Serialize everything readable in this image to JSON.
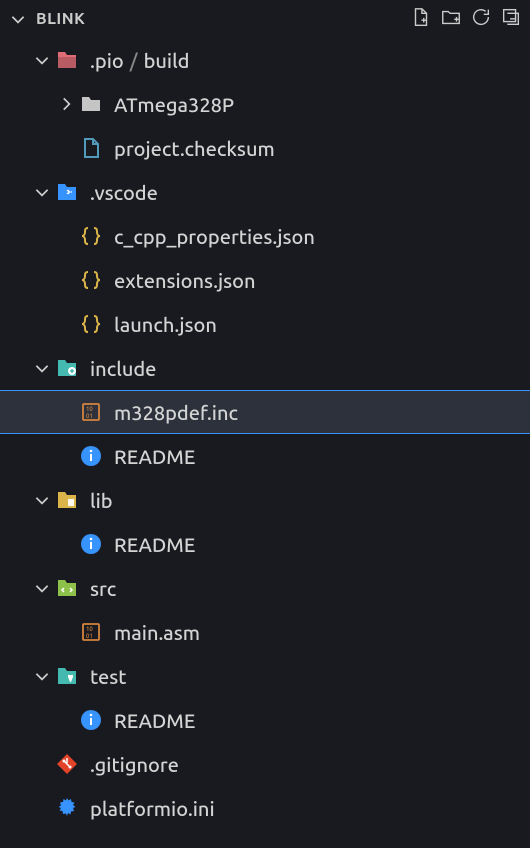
{
  "header": {
    "title": "BLINK"
  },
  "tree": {
    "pio": {
      "part1": ".pio",
      "part2": "build"
    },
    "atmega": "ATmega328P",
    "project_checksum": "project.checksum",
    "vscode": ".vscode",
    "c_cpp": "c_cpp_properties.json",
    "extensions": "extensions.json",
    "launch": "launch.json",
    "include": "include",
    "m328pdef": "m328pdef.inc",
    "readme1": "README",
    "lib": "lib",
    "readme2": "README",
    "src": "src",
    "mainasm": "main.asm",
    "test": "test",
    "readme3": "README",
    "gitignore": ".gitignore",
    "platformio": "platformio.ini"
  }
}
